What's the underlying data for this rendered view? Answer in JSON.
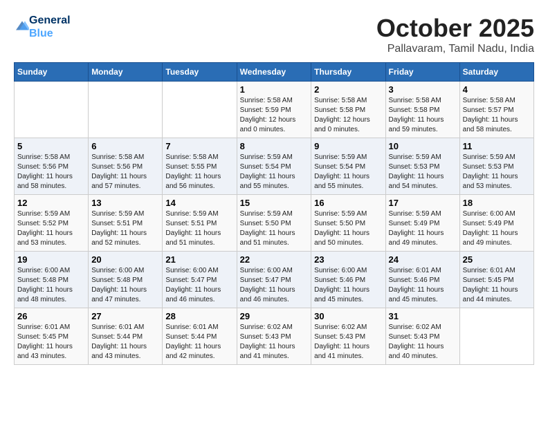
{
  "logo": {
    "line1": "General",
    "line2": "Blue"
  },
  "title": "October 2025",
  "subtitle": "Pallavaram, Tamil Nadu, India",
  "headers": [
    "Sunday",
    "Monday",
    "Tuesday",
    "Wednesday",
    "Thursday",
    "Friday",
    "Saturday"
  ],
  "weeks": [
    [
      {
        "day": "",
        "info": ""
      },
      {
        "day": "",
        "info": ""
      },
      {
        "day": "",
        "info": ""
      },
      {
        "day": "1",
        "info": "Sunrise: 5:58 AM\nSunset: 5:59 PM\nDaylight: 12 hours\nand 0 minutes."
      },
      {
        "day": "2",
        "info": "Sunrise: 5:58 AM\nSunset: 5:58 PM\nDaylight: 12 hours\nand 0 minutes."
      },
      {
        "day": "3",
        "info": "Sunrise: 5:58 AM\nSunset: 5:58 PM\nDaylight: 11 hours\nand 59 minutes."
      },
      {
        "day": "4",
        "info": "Sunrise: 5:58 AM\nSunset: 5:57 PM\nDaylight: 11 hours\nand 58 minutes."
      }
    ],
    [
      {
        "day": "5",
        "info": "Sunrise: 5:58 AM\nSunset: 5:56 PM\nDaylight: 11 hours\nand 58 minutes."
      },
      {
        "day": "6",
        "info": "Sunrise: 5:58 AM\nSunset: 5:56 PM\nDaylight: 11 hours\nand 57 minutes."
      },
      {
        "day": "7",
        "info": "Sunrise: 5:58 AM\nSunset: 5:55 PM\nDaylight: 11 hours\nand 56 minutes."
      },
      {
        "day": "8",
        "info": "Sunrise: 5:59 AM\nSunset: 5:54 PM\nDaylight: 11 hours\nand 55 minutes."
      },
      {
        "day": "9",
        "info": "Sunrise: 5:59 AM\nSunset: 5:54 PM\nDaylight: 11 hours\nand 55 minutes."
      },
      {
        "day": "10",
        "info": "Sunrise: 5:59 AM\nSunset: 5:53 PM\nDaylight: 11 hours\nand 54 minutes."
      },
      {
        "day": "11",
        "info": "Sunrise: 5:59 AM\nSunset: 5:53 PM\nDaylight: 11 hours\nand 53 minutes."
      }
    ],
    [
      {
        "day": "12",
        "info": "Sunrise: 5:59 AM\nSunset: 5:52 PM\nDaylight: 11 hours\nand 53 minutes."
      },
      {
        "day": "13",
        "info": "Sunrise: 5:59 AM\nSunset: 5:51 PM\nDaylight: 11 hours\nand 52 minutes."
      },
      {
        "day": "14",
        "info": "Sunrise: 5:59 AM\nSunset: 5:51 PM\nDaylight: 11 hours\nand 51 minutes."
      },
      {
        "day": "15",
        "info": "Sunrise: 5:59 AM\nSunset: 5:50 PM\nDaylight: 11 hours\nand 51 minutes."
      },
      {
        "day": "16",
        "info": "Sunrise: 5:59 AM\nSunset: 5:50 PM\nDaylight: 11 hours\nand 50 minutes."
      },
      {
        "day": "17",
        "info": "Sunrise: 5:59 AM\nSunset: 5:49 PM\nDaylight: 11 hours\nand 49 minutes."
      },
      {
        "day": "18",
        "info": "Sunrise: 6:00 AM\nSunset: 5:49 PM\nDaylight: 11 hours\nand 49 minutes."
      }
    ],
    [
      {
        "day": "19",
        "info": "Sunrise: 6:00 AM\nSunset: 5:48 PM\nDaylight: 11 hours\nand 48 minutes."
      },
      {
        "day": "20",
        "info": "Sunrise: 6:00 AM\nSunset: 5:48 PM\nDaylight: 11 hours\nand 47 minutes."
      },
      {
        "day": "21",
        "info": "Sunrise: 6:00 AM\nSunset: 5:47 PM\nDaylight: 11 hours\nand 46 minutes."
      },
      {
        "day": "22",
        "info": "Sunrise: 6:00 AM\nSunset: 5:47 PM\nDaylight: 11 hours\nand 46 minutes."
      },
      {
        "day": "23",
        "info": "Sunrise: 6:00 AM\nSunset: 5:46 PM\nDaylight: 11 hours\nand 45 minutes."
      },
      {
        "day": "24",
        "info": "Sunrise: 6:01 AM\nSunset: 5:46 PM\nDaylight: 11 hours\nand 45 minutes."
      },
      {
        "day": "25",
        "info": "Sunrise: 6:01 AM\nSunset: 5:45 PM\nDaylight: 11 hours\nand 44 minutes."
      }
    ],
    [
      {
        "day": "26",
        "info": "Sunrise: 6:01 AM\nSunset: 5:45 PM\nDaylight: 11 hours\nand 43 minutes."
      },
      {
        "day": "27",
        "info": "Sunrise: 6:01 AM\nSunset: 5:44 PM\nDaylight: 11 hours\nand 43 minutes."
      },
      {
        "day": "28",
        "info": "Sunrise: 6:01 AM\nSunset: 5:44 PM\nDaylight: 11 hours\nand 42 minutes."
      },
      {
        "day": "29",
        "info": "Sunrise: 6:02 AM\nSunset: 5:43 PM\nDaylight: 11 hours\nand 41 minutes."
      },
      {
        "day": "30",
        "info": "Sunrise: 6:02 AM\nSunset: 5:43 PM\nDaylight: 11 hours\nand 41 minutes."
      },
      {
        "day": "31",
        "info": "Sunrise: 6:02 AM\nSunset: 5:43 PM\nDaylight: 11 hours\nand 40 minutes."
      },
      {
        "day": "",
        "info": ""
      }
    ]
  ]
}
